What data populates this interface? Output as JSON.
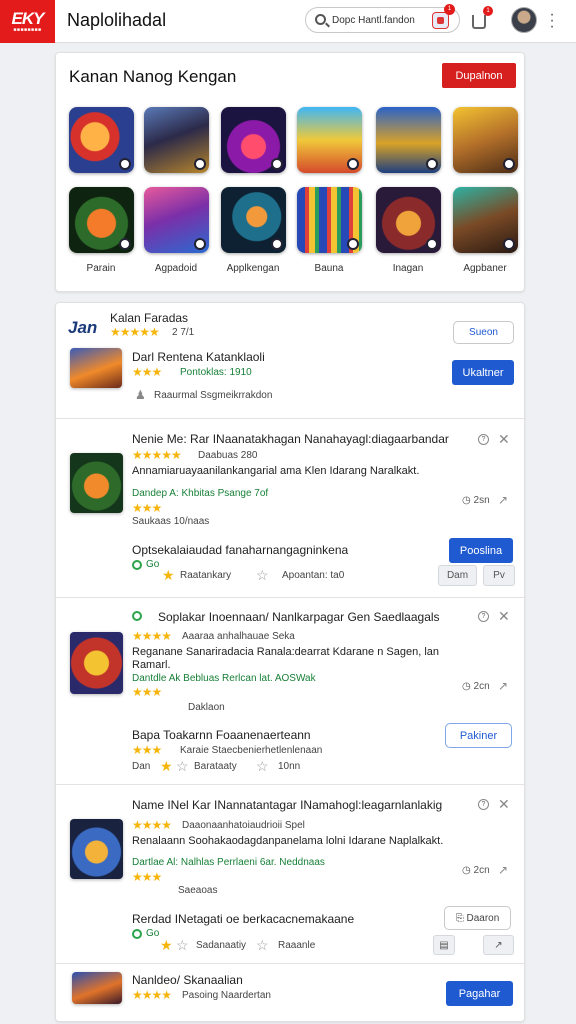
{
  "header": {
    "logo_text": "EKY",
    "logo_sub": "■■■■■■■■",
    "app_title": "Naplolihadal",
    "search_value": "Dopc Hantl.fandon",
    "search_badge": "1",
    "cart_badge": "1"
  },
  "featured": {
    "title": "Kanan Nanog Kengan",
    "button": "Dupalnon",
    "labels": [
      "Parain",
      "Agpadoid",
      "Applkengan",
      "Bauna",
      "Inagan",
      "Agpbaner"
    ]
  },
  "list": {
    "header": {
      "logo": "Jan",
      "title": "Kalan Faradas",
      "stars": "★★★★★",
      "rating": "2 7/1",
      "button": "Sueon",
      "row_title": "Darl Rentena Katanklaoli",
      "row_stars": "★★★",
      "row_sub": "Pontoklas: 1910",
      "row_meta": "Raaurmal Ssgmeikrrakdon",
      "row_button": "Ukaltner"
    },
    "items": [
      {
        "title": "Nenie Me: Rar INaanatakhagan Nanahayagl:diagaarbandar",
        "stars": "★★★★★",
        "sub": "Daabuas 280",
        "desc": "Annamiaruayaanilankangarial ama Klen Idarang Naralkakt.",
        "green": "Dandep A: Khbitas Psange 7of",
        "stars2": "★★★",
        "sub2": "Saukaas 10/naas",
        "chat": "2sn",
        "row_title": "Optsekalaiaudad fanaharnangagninkena",
        "row_green": "Go",
        "row_meta1": "Raatankary",
        "row_meta2": "Apoantan: ta0",
        "button": "Pooslina",
        "gray1": "Dam",
        "gray2": "Pv"
      },
      {
        "title": "Soplakar Inoennaan/ Nanlkarpagar Gen Saedlaagals",
        "stars": "★★★★",
        "sub": "Aaaraa anhalhauae Seka",
        "desc": "Reganane Sanariradacia Ranala:dearrat Kdarane n Sagen, lan Ramarl.",
        "green": "Dantdle Ak Bebluas Rerlcan lat. AOSWak",
        "stars2": "★★★",
        "sub2": "Daklaon",
        "chat": "2cn",
        "row_title": "Bapa Toakarnn Foaanenaerteann",
        "row_stars": "★★★",
        "row_sub": "Karaie Staecbenierhetlenlenaan",
        "row_meta0": "Dan",
        "row_meta1": "Barataaty",
        "row_meta2": "10nn",
        "button": "Pakiner"
      },
      {
        "title": "Name INel Kar INannatantagar INamahogl:leagarnlanlakig",
        "stars": "★★★★",
        "sub": "Daaonaanhatoiaudrioii Spel",
        "desc": "Renalaann Soohakaodagdanpanelama lolni Idarane Naplalkakt.",
        "green": "Dartlae Al: Nalhlas Perrlaeni 6ar. Neddnaas",
        "stars2": "★★★",
        "sub2": "Saeaoas",
        "chat": "2cn",
        "row_title": "Rerdad INetagati oe berkacacnemakaane",
        "row_green": "Go",
        "row_meta1": "Sadanaatiy",
        "row_meta2": "Raaanle",
        "button": "Daaron"
      }
    ],
    "footer": {
      "title": "Nanldeo/ Skanaalian",
      "stars": "★★★★",
      "sub": "Pasoing Naardertan",
      "button": "Pagahar"
    }
  },
  "colors": {
    "accent": "#1f5ad1",
    "brand_red": "#d61f1f",
    "star": "#f5b50a",
    "green": "#188038"
  }
}
